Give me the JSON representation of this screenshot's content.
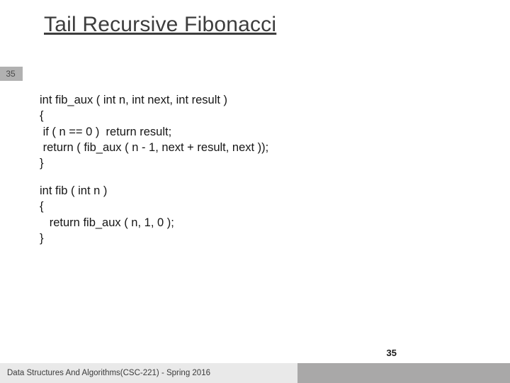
{
  "title": "Tail Recursive Fibonacci",
  "page_badge": "35",
  "code": {
    "block1": "int fib_aux ( int n, int next, int result )\n{\n if ( n == 0 )  return result;\n return ( fib_aux ( n - 1, next + result, next ));\n}",
    "block2": "int fib ( int n )\n{\n   return fib_aux ( n, 1, 0 );\n}"
  },
  "footer": {
    "page_number": "35",
    "text": "Data Structures And Algorithms(CSC-221) - Spring 2016"
  }
}
